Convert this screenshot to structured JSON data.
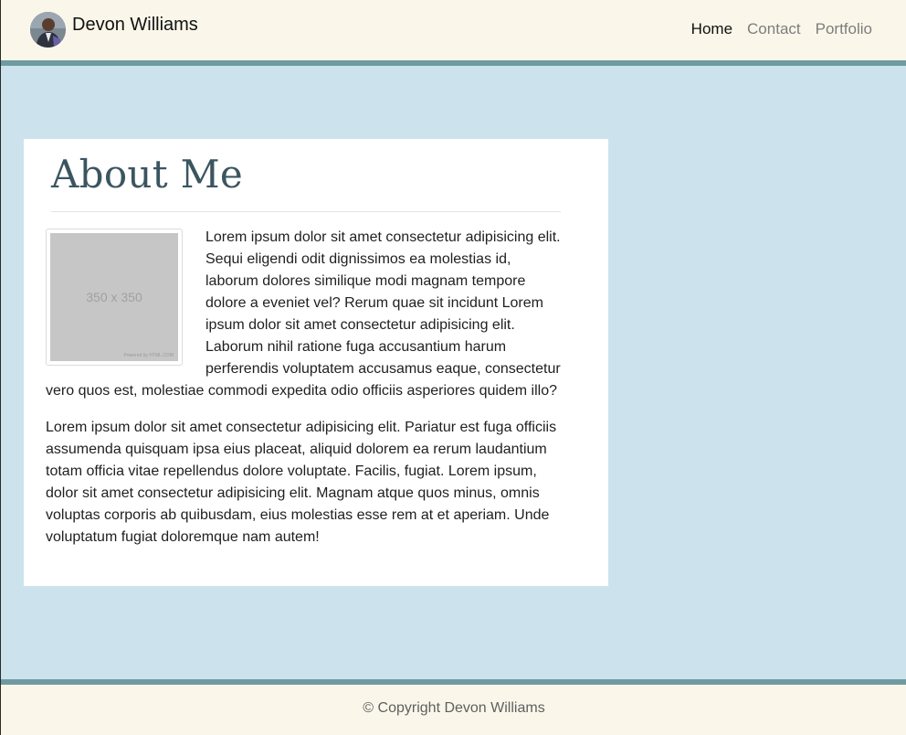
{
  "navbar": {
    "brand_name": "Devon Williams",
    "links": [
      {
        "label": "Home",
        "active": true
      },
      {
        "label": "Contact",
        "active": false
      },
      {
        "label": "Portfolio",
        "active": false
      }
    ]
  },
  "about": {
    "title": "About Me",
    "image_placeholder": "350 x 350",
    "image_credit": "Powered by HTML.COM",
    "paragraphs": [
      "Lorem ipsum dolor sit amet consectetur adipisicing elit. Sequi eligendi odit dignissimos ea molestias id, laborum dolores similique modi magnam tempore dolore a eveniet vel? Rerum quae sit incidunt Lorem ipsum dolor sit amet consectetur adipisicing elit. Laborum nihil ratione fuga accusantium harum perferendis voluptatem accusamus eaque, consectetur vero quos est, molestiae commodi expedita odio officiis asperiores quidem illo?",
      "Lorem ipsum dolor sit amet consectetur adipisicing elit. Pariatur est fuga officiis assumenda quisquam ipsa eius placeat, aliquid dolorem ea rerum laudantium totam officia vitae repellendus dolore voluptate. Facilis, fugiat. Lorem ipsum, dolor sit amet consectetur adipisicing elit. Magnam atque quos minus, omnis voluptas corporis ab quibusdam, eius molestias esse rem at et aperiam. Unde voluptatum fugiat doloremque nam autem!"
    ]
  },
  "footer": {
    "copyright": "© Copyright Devon Williams"
  },
  "colors": {
    "background": "#cce3ee",
    "bar": "#faf7ea",
    "accent_border": "#6f9aa1",
    "title": "#3b5560"
  }
}
